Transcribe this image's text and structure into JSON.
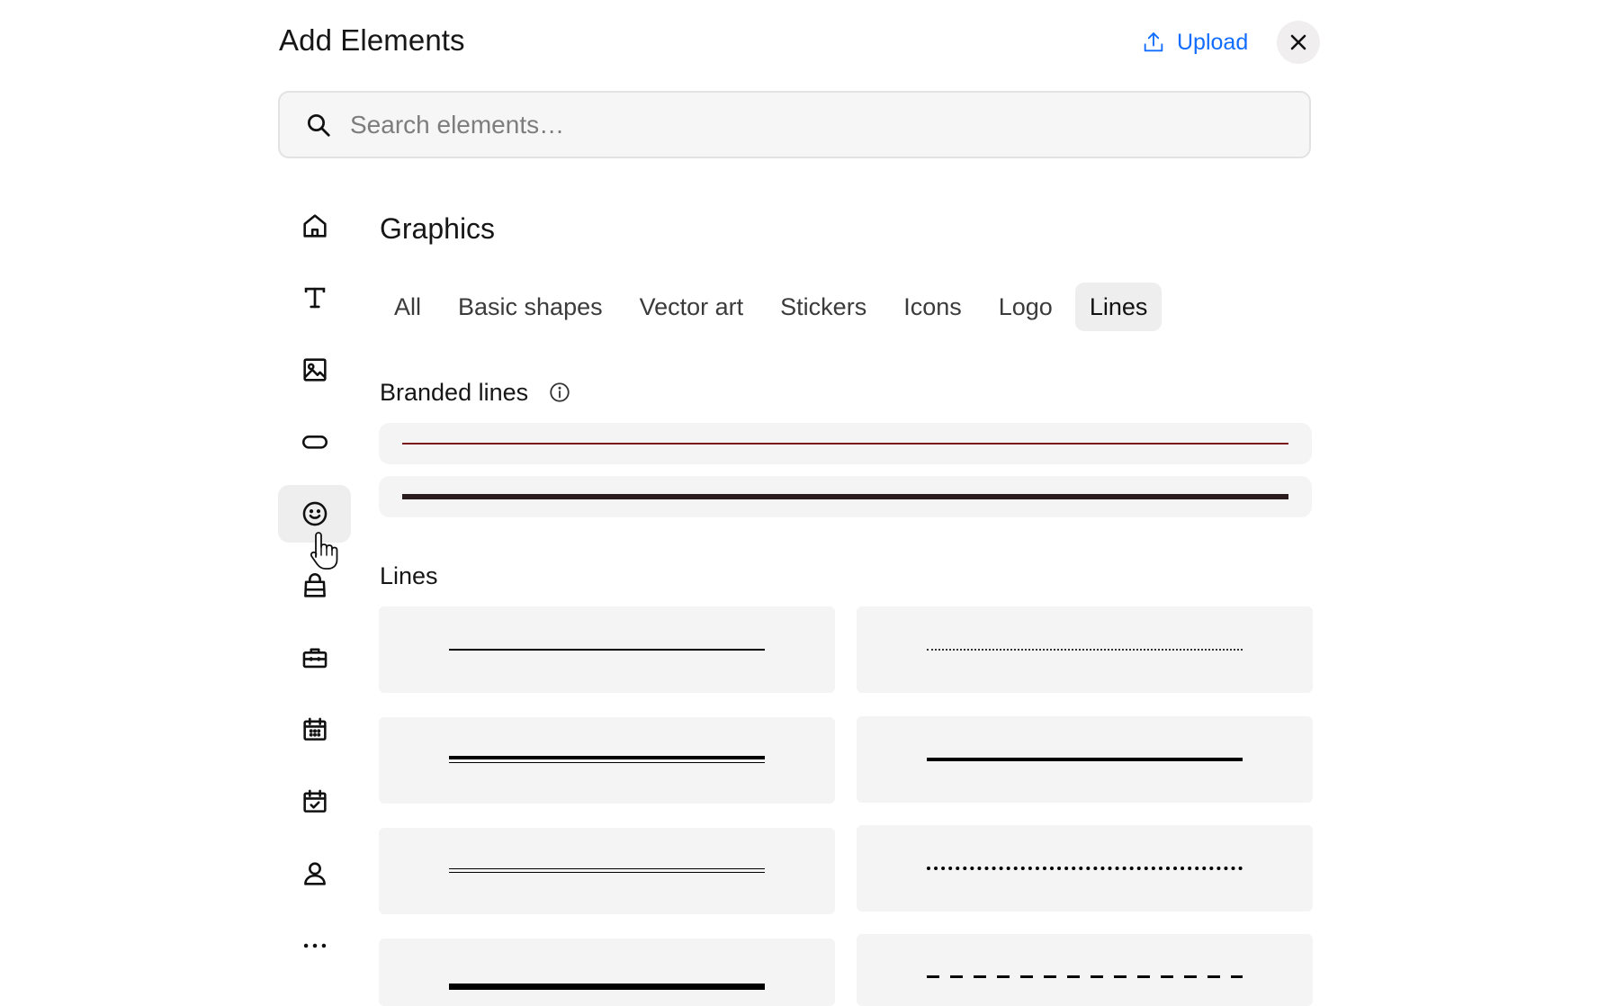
{
  "header": {
    "title": "Add Elements",
    "upload_label": "Upload",
    "close_icon": "close-icon",
    "upload_icon": "upload-icon"
  },
  "search": {
    "placeholder": "Search elements…",
    "value": ""
  },
  "rail": {
    "items": [
      {
        "name": "home",
        "icon": "home-icon",
        "active": false
      },
      {
        "name": "text",
        "icon": "text-icon",
        "active": false
      },
      {
        "name": "image",
        "icon": "image-icon",
        "active": false
      },
      {
        "name": "button",
        "icon": "button-icon",
        "active": false
      },
      {
        "name": "graphics",
        "icon": "smiley-icon",
        "active": true
      },
      {
        "name": "store",
        "icon": "shopping-bag-icon",
        "active": false
      },
      {
        "name": "business",
        "icon": "briefcase-icon",
        "active": false
      },
      {
        "name": "events",
        "icon": "calendar-icon",
        "active": false
      },
      {
        "name": "bookings",
        "icon": "calendar-check-icon",
        "active": false
      },
      {
        "name": "members",
        "icon": "person-icon",
        "active": false
      },
      {
        "name": "more",
        "icon": "more-icon",
        "active": false
      }
    ]
  },
  "section": {
    "title": "Graphics",
    "tabs": [
      {
        "label": "All",
        "active": false
      },
      {
        "label": "Basic shapes",
        "active": false
      },
      {
        "label": "Vector art",
        "active": false
      },
      {
        "label": "Stickers",
        "active": false
      },
      {
        "label": "Icons",
        "active": false
      },
      {
        "label": "Logo",
        "active": false
      },
      {
        "label": "Lines",
        "active": true
      }
    ]
  },
  "branded_lines": {
    "title": "Branded lines",
    "info_icon": "info-icon",
    "items": [
      {
        "color": "#7a1a1a",
        "style": "solid thin"
      },
      {
        "color": "#2a1c1c",
        "style": "solid thick"
      }
    ]
  },
  "lines": {
    "title": "Lines",
    "items": [
      {
        "style": "solid thin",
        "color": "#000000"
      },
      {
        "style": "dotted thin",
        "color": "#000000"
      },
      {
        "style": "double thick-thin",
        "color": "#000000"
      },
      {
        "style": "solid medium",
        "color": "#000000"
      },
      {
        "style": "double thin",
        "color": "#000000"
      },
      {
        "style": "dotted medium",
        "color": "#000000"
      },
      {
        "style": "solid thick",
        "color": "#000000"
      },
      {
        "style": "dashed",
        "color": "#000000"
      }
    ]
  },
  "colors": {
    "accent": "#116dff",
    "tile_bg": "#f5f4f4",
    "active_bg": "#efeeee"
  }
}
